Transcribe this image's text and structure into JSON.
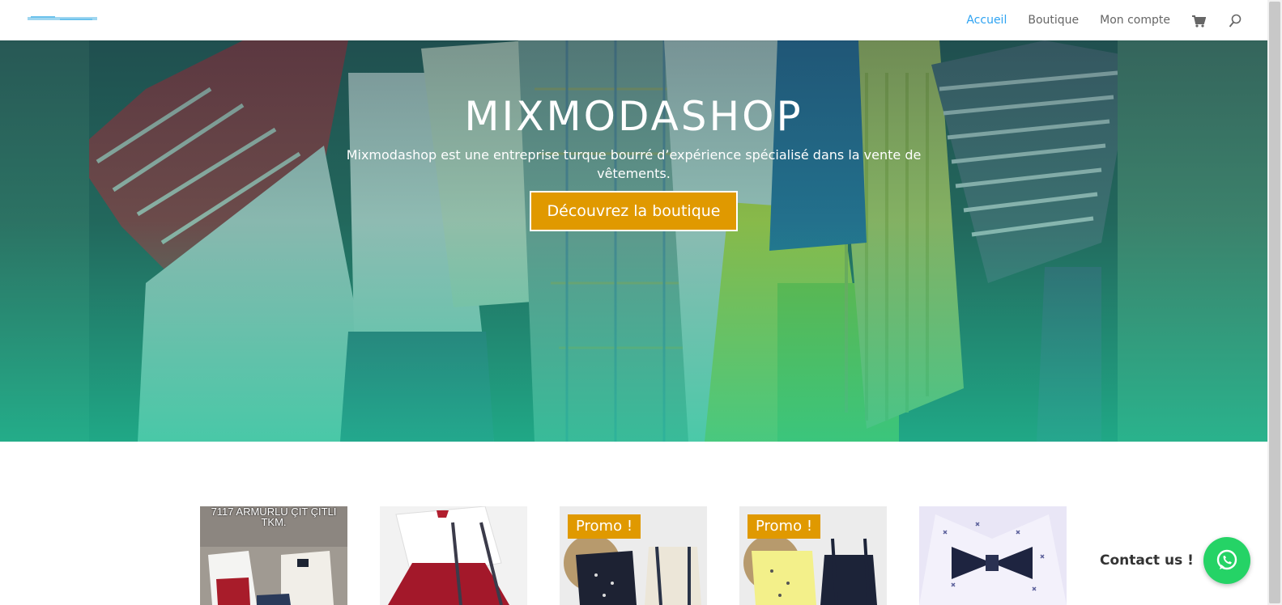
{
  "nav": {
    "items": [
      {
        "label": "Accueil",
        "active": true
      },
      {
        "label": "Boutique",
        "active": false
      },
      {
        "label": "Mon compte",
        "active": false
      }
    ],
    "cart_icon": "cart-icon",
    "search_icon": "search-icon",
    "active_color": "#2ea3f2"
  },
  "hero": {
    "title": "MIXMODASHOP",
    "subtitle": "Mixmodashop est une entreprise turque bourré d’expérience spécialisé dans la vente de vêtements.",
    "cta_label": "Découvrez la boutique",
    "accent_color": "#e09900"
  },
  "products": [
    {
      "caption": "7117 ARMURLU ÇIT ÇITLI TKM.",
      "badge": ""
    },
    {
      "caption": "",
      "badge": ""
    },
    {
      "caption": "",
      "badge": "Promo !"
    },
    {
      "caption": "",
      "badge": "Promo !"
    },
    {
      "caption": "",
      "badge": ""
    }
  ],
  "contact": {
    "label": "Contact us !",
    "icon": "whatsapp-icon",
    "color": "#25d366"
  }
}
